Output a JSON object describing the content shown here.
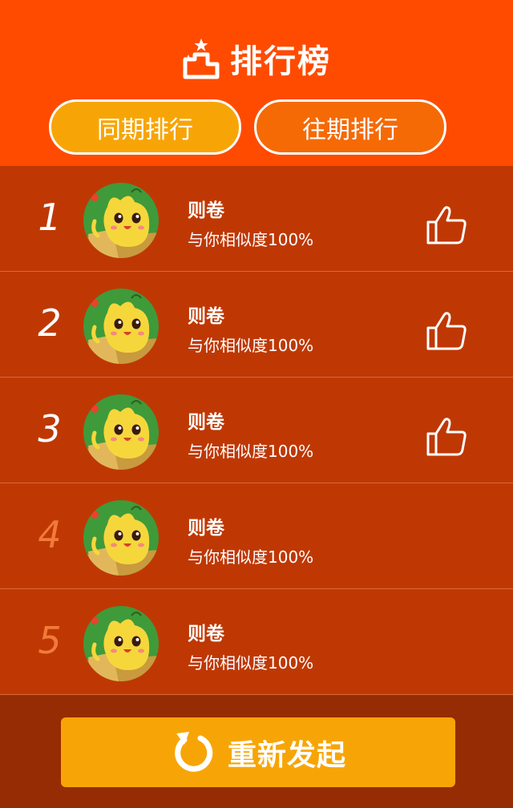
{
  "header": {
    "title": "排行榜",
    "title_icon": "podium-icon",
    "tabs": [
      {
        "label": "同期排行",
        "active": true
      },
      {
        "label": "往期排行",
        "active": false
      }
    ]
  },
  "ranking": [
    {
      "rank": "1",
      "name": "则卷",
      "similarity": "与你相似度100%",
      "liked": true
    },
    {
      "rank": "2",
      "name": "则卷",
      "similarity": "与你相似度100%",
      "liked": true
    },
    {
      "rank": "3",
      "name": "则卷",
      "similarity": "与你相似度100%",
      "liked": true
    },
    {
      "rank": "4",
      "name": "则卷",
      "similarity": "与你相似度100%",
      "liked": false
    },
    {
      "rank": "5",
      "name": "则卷",
      "similarity": "与你相似度100%",
      "liked": false
    }
  ],
  "footer": {
    "restart_label": "重新发起",
    "restart_icon": "refresh-icon"
  },
  "colors": {
    "header_bg": "#ff4b00",
    "list_bg": "#bf3804",
    "footer_bg": "#962c03",
    "accent": "#f7a506",
    "rank_top_color": "#ffffff",
    "rank_other_color": "#f27a3a"
  }
}
